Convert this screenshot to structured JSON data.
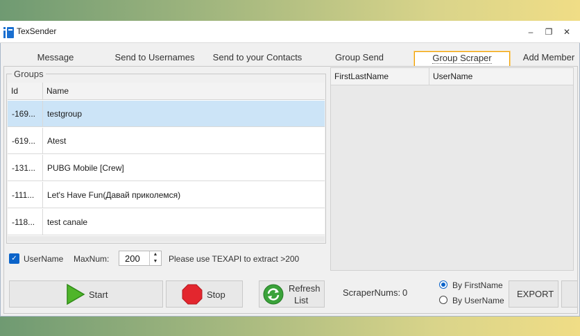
{
  "window": {
    "title": "TexSender"
  },
  "tabs": [
    {
      "label": "Message"
    },
    {
      "label": "Send to Usernames"
    },
    {
      "label": "Send to your Contacts"
    },
    {
      "label": "Group Send"
    },
    {
      "label": "Group Scraper",
      "active": true
    },
    {
      "label": "Add Member"
    }
  ],
  "groups": {
    "legend": "Groups",
    "columns": [
      "Id",
      "Name"
    ],
    "rows": [
      {
        "id": "-169...",
        "name": "testgroup",
        "selected": true
      },
      {
        "id": "-619...",
        "name": "Atest"
      },
      {
        "id": "-131...",
        "name": "PUBG Mobile [Crew]"
      },
      {
        "id": "-111...",
        "name": "Let's Have Fun(Давай приколемся)"
      },
      {
        "id": "-118...",
        "name": "test canale"
      }
    ]
  },
  "results": {
    "columns": [
      "FirstLastName",
      "UserName"
    ]
  },
  "options": {
    "username_label": "UserName",
    "maxnum_label": "MaxNum:",
    "maxnum_value": "200",
    "hint": "Please use TEXAPI to extract >200"
  },
  "buttons": {
    "start": "Start",
    "stop": "Stop",
    "refresh_line1": "Refresh",
    "refresh_line2": "List",
    "export": "EXPORT"
  },
  "scraper": {
    "nums_label": "ScraperNums:",
    "nums_value": "0",
    "by_firstname": "By FirstName",
    "by_username": "By UserName"
  },
  "colors": {
    "accent": "#0a63c9",
    "selected_row": "#cce4f7",
    "tab_highlight": "#f0a000"
  }
}
